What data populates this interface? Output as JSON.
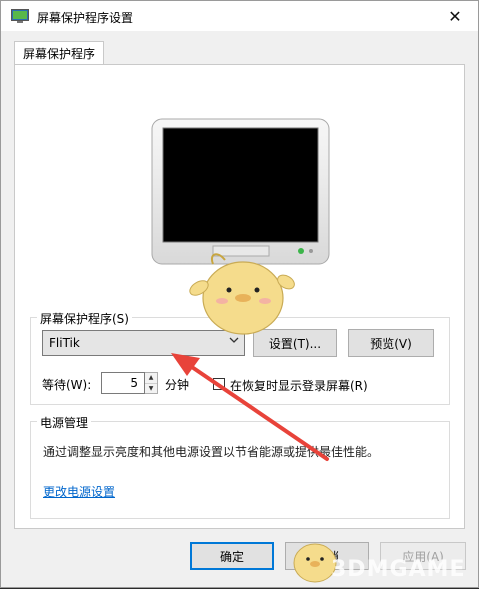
{
  "window": {
    "title": "屏幕保护程序设置",
    "close_symbol": "✕"
  },
  "tabs": [
    {
      "label": "屏幕保护程序"
    }
  ],
  "screensaver": {
    "group_title": "屏幕保护程序(S)",
    "selected": "FliTik",
    "settings_label": "设置(T)...",
    "preview_label": "预览(V)",
    "wait_label": "等待(W):",
    "wait_value": "5",
    "minutes_label": "分钟",
    "resume_label": "在恢复时显示登录屏幕(R)",
    "resume_checked": false
  },
  "power": {
    "group_title": "电源管理",
    "description": "通过调整显示亮度和其他电源设置以节省能源或提供最佳性能。",
    "link": "更改电源设置"
  },
  "footer": {
    "ok_label": "确定",
    "cancel_label": "取消",
    "apply_label": "应用(A)"
  },
  "watermark": {
    "text": "3DMGAME"
  },
  "colors": {
    "accent": "#0078d7",
    "link": "#0066cc",
    "arrow": "#e8433a",
    "mascot": "#f5dc8c"
  }
}
